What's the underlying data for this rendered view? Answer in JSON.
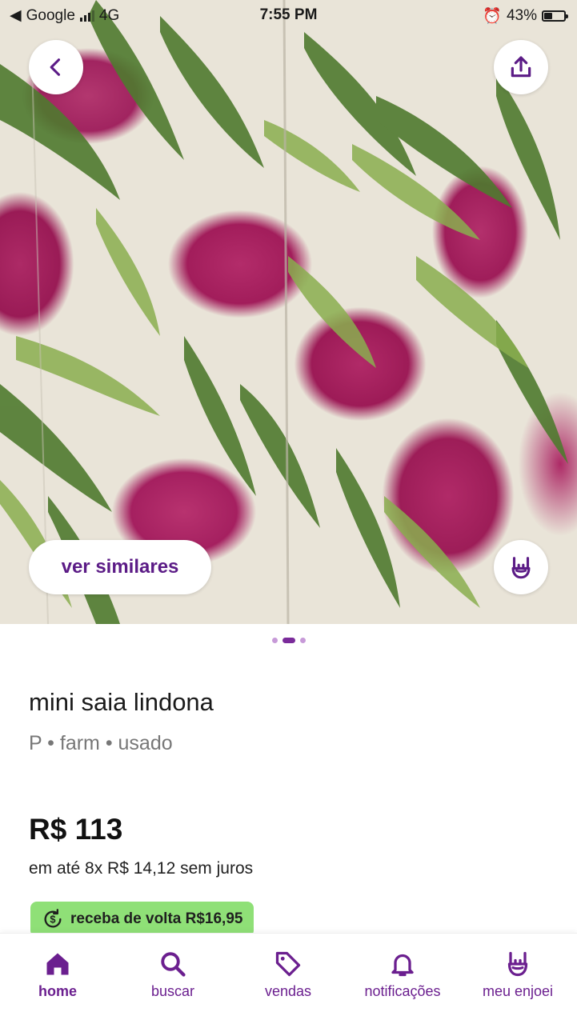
{
  "status_bar": {
    "carrier": "Google",
    "network": "4G",
    "time": "7:55 PM",
    "battery": "43%",
    "battery_level": 0.43
  },
  "product": {
    "similar_label": "ver similares",
    "title": "mini saia lindona",
    "subtitle": "P • farm • usado",
    "price": "R$ 113",
    "installments": "em até 8x R$ 14,12 sem juros",
    "cashback": "receba de volta R$16,95",
    "image_count": 3,
    "active_image": 2
  },
  "icons": {
    "back": "chevron-left-icon",
    "share": "share-upload-icon",
    "like": "rock-hand-icon",
    "cashback": "dollar-refresh-icon"
  },
  "tabs": [
    {
      "label": "home",
      "icon": "home-icon",
      "active": true
    },
    {
      "label": "buscar",
      "icon": "search-icon",
      "active": false
    },
    {
      "label": "vendas",
      "icon": "tag-icon",
      "active": false
    },
    {
      "label": "notificações",
      "icon": "bell-icon",
      "active": false
    },
    {
      "label": "meu enjoei",
      "icon": "rock-hand-icon",
      "active": false
    }
  ],
  "colors": {
    "brand_purple": "#6b1f8f",
    "cashback_green": "#8fe077",
    "dot_active": "#7a2b9a",
    "dot_inactive": "#c79ad8"
  }
}
